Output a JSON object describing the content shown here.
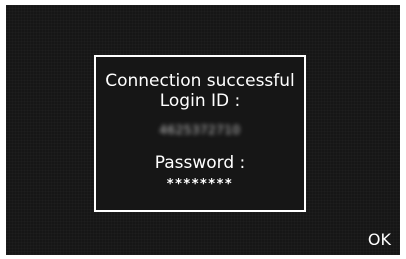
{
  "dialog": {
    "title": "Connection successful",
    "login_id_label": "Login ID :",
    "login_id_value": "4625372710",
    "password_label": "Password :",
    "password_value": "********"
  },
  "actions": {
    "ok_label": "OK"
  },
  "colors": {
    "screen_background": "#161616",
    "text": "#ffffff",
    "dialog_border": "#ffffff"
  }
}
